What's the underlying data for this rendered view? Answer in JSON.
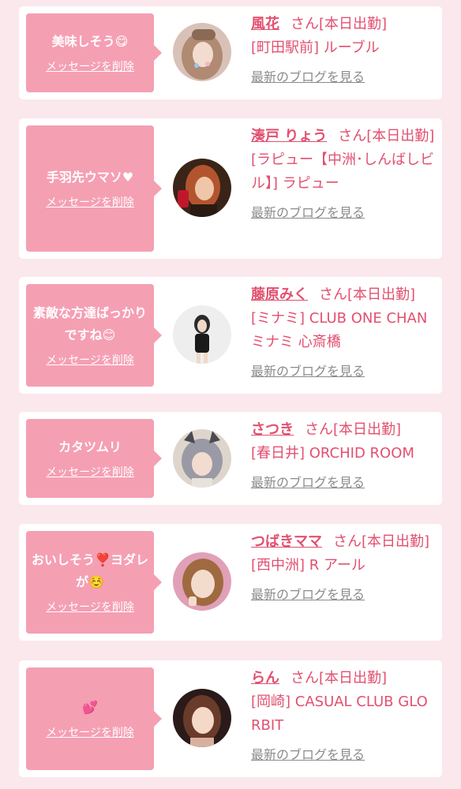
{
  "colors": {
    "background": "#fae8ec",
    "bubble": "#f59fb3",
    "accent": "#e2506f",
    "muted": "#8b8b8b"
  },
  "entries": [
    {
      "message": "美味しそう😋",
      "delete_label": "メッセージを削除",
      "name": "風花",
      "san_label": "さん[本日出勤]",
      "shop": "[町田駅前] ルーブル",
      "blog_label": "最新のブログを見る"
    },
    {
      "message": "手羽先ウマソ♥",
      "delete_label": "メッセージを削除",
      "name": "湊戸 りょう",
      "san_label": "さん[本日出勤]",
      "shop": "[ラピュー【中洲･しんばしビル】] ラピュー",
      "blog_label": "最新のブログを見る"
    },
    {
      "message": "素敵な方達ばっかりですね😊",
      "delete_label": "メッセージを削除",
      "name": "藤原みく",
      "san_label": "さん[本日出勤]",
      "shop": "[ミナミ] CLUB ONE CHAN ミナミ 心斎橋",
      "blog_label": "最新のブログを見る"
    },
    {
      "message": "カタツムリ",
      "delete_label": "メッセージを削除",
      "name": "さつき",
      "san_label": "さん[本日出勤]",
      "shop": "[春日井] ORCHID ROOM",
      "blog_label": "最新のブログを見る"
    },
    {
      "message": "おいしそう❣️ヨダレが☺️",
      "delete_label": "メッセージを削除",
      "name": "つばきママ",
      "san_label": "さん[本日出勤]",
      "shop": "[西中洲] R アール",
      "blog_label": "最新のブログを見る"
    },
    {
      "message": "💕",
      "delete_label": "メッセージを削除",
      "name": "らん",
      "san_label": "さん[本日出勤]",
      "shop": "[岡崎] CASUAL CLUB GLORBIT",
      "blog_label": "最新のブログを見る"
    }
  ]
}
